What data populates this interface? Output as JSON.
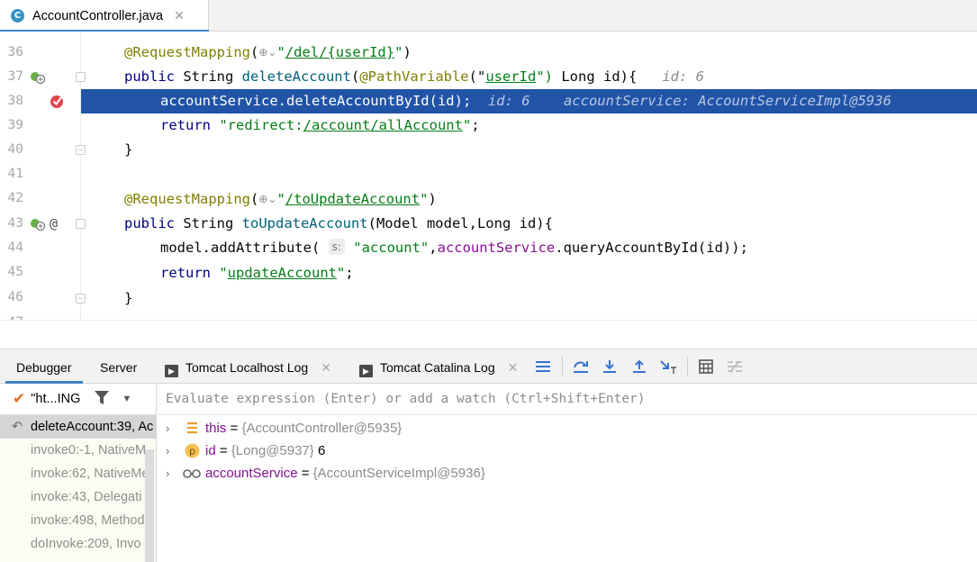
{
  "editor_tab": {
    "icon_letter": "C",
    "filename": "AccountController.java",
    "close": "✕"
  },
  "code": {
    "lines": [
      {
        "num": "37"
      },
      {
        "num": "38"
      },
      {
        "num": "39"
      },
      {
        "num": "40"
      },
      {
        "num": "41"
      },
      {
        "num": "42"
      },
      {
        "num": "43"
      },
      {
        "num": "44"
      },
      {
        "num": "45"
      },
      {
        "num": "46"
      },
      {
        "num": "47"
      }
    ],
    "l37": {
      "annot": "@RequestMapping",
      "open": "(",
      "globe": "⊕⌄",
      "q1": "\"",
      "path": "/del/{userId}",
      "q2": "\"",
      "close": ")"
    },
    "l38": {
      "kw": "public",
      "type": " String ",
      "method": "deleteAccount",
      "open": "(",
      "annot": "@PathVariable",
      "p1": "(\"",
      "arg": "userId",
      "p2": "\")",
      "rest": " Long id){",
      "hint": "id: 6"
    },
    "l39": {
      "field": "accountService",
      "call": ".deleteAccountById(id);",
      "hint1": "id: 6",
      "hint2": "accountService: AccountServiceImpl@5936"
    },
    "l40": {
      "kw": "return",
      "q1": " \"redirect:",
      "path": "/account/allAccount",
      "q2": "\"",
      "end": ";"
    },
    "l41": {
      "text": "}"
    },
    "l43": {
      "annot": "@RequestMapping",
      "open": "(",
      "globe": "⊕⌄",
      "q1": "\"",
      "path": "/toUpdateAccount",
      "q2": "\"",
      "close": ")"
    },
    "l44": {
      "kw": "public",
      "type": " String ",
      "method": "toUpdateAccount",
      "rest": "(Model model,Long id){"
    },
    "l45": {
      "pre": "model.addAttribute( ",
      "hint": "s:",
      "str": " \"account\"",
      "comma": ",",
      "field": "accountService",
      "rest": ".queryAccountById(id));"
    },
    "l46": {
      "kw": "return",
      "q1": " \"",
      "path": "updateAccount",
      "q2": "\"",
      "end": ";"
    },
    "l47": {
      "text": "}"
    },
    "gutter_at": "@"
  },
  "debug": {
    "tabs": {
      "debugger": "Debugger",
      "server": "Server",
      "localhost_log": "Tomcat Localhost Log",
      "catalina_log": "Tomcat Catalina Log",
      "close": "✕"
    },
    "thread": {
      "check": "✔",
      "name": "\"ht...ING"
    },
    "eval_placeholder": "Evaluate expression (Enter) or add a watch (Ctrl+Shift+Enter)",
    "frames": [
      "deleteAccount:39, Ac",
      "invoke0:-1, NativeM",
      "invoke:62, NativeMe",
      "invoke:43, Delegati",
      "invoke:498, Method",
      "doInvoke:209, Invo"
    ],
    "variables": [
      {
        "name": "this",
        "eq": " = ",
        "value": "{AccountController@5935}",
        "extra": ""
      },
      {
        "name": "id",
        "eq": " = ",
        "value": "{Long@5937}",
        "extra": " 6"
      },
      {
        "name": "accountService",
        "eq": " = ",
        "value": "{AccountServiceImpl@5936}",
        "extra": ""
      }
    ],
    "var_chevron": "›"
  },
  "colors": {
    "highlight": "#2154a6",
    "accent": "#4083c9",
    "field": "#871094",
    "string": "#067d17",
    "keyword": "#000080",
    "annotation": "#808000"
  }
}
